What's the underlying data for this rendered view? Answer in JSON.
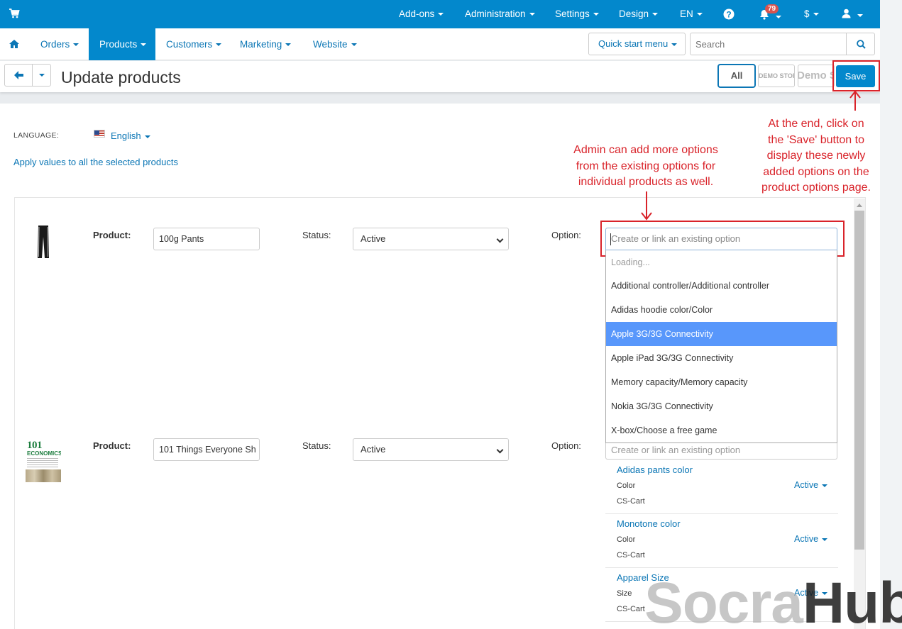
{
  "topbar": {
    "items": [
      {
        "label": "Add-ons"
      },
      {
        "label": "Administration"
      },
      {
        "label": "Settings"
      },
      {
        "label": "Design"
      },
      {
        "label": "EN"
      }
    ],
    "notification_count": "79",
    "currency": "$",
    "icons": [
      "cart-icon",
      "help-icon",
      "bell-icon",
      "user-icon"
    ]
  },
  "nav": {
    "items": [
      {
        "label": "Orders"
      },
      {
        "label": "Products"
      },
      {
        "label": "Customers"
      },
      {
        "label": "Marketing"
      },
      {
        "label": "Website"
      }
    ],
    "quick_start": "Quick start menu",
    "search_placeholder": "Search"
  },
  "header": {
    "title": "Update products",
    "storefront_all": "All",
    "storefront_1": "DEMO STORE",
    "storefront_2": "Demo Store",
    "save": "Save"
  },
  "language": {
    "label": "LANGUAGE:",
    "value": "English"
  },
  "apply_link": "Apply values to all the selected products",
  "products": [
    {
      "product_label": "Product:",
      "name": "100g Pants",
      "status_label": "Status:",
      "status": "Active",
      "option_label": "Option:",
      "option_placeholder": "Create or link an existing option"
    },
    {
      "product_label": "Product:",
      "name": "101 Things Everyone Sh",
      "status_label": "Status:",
      "status": "Active",
      "option_label": "Option:",
      "option_placeholder": "Create or link an existing option",
      "image_text": {
        "number": "101",
        "title": "ECONOMICS"
      }
    }
  ],
  "dropdown": {
    "items": [
      "Loading...",
      "Additional controller/Additional controller",
      "Adidas hoodie color/Color",
      "Apple 3G/3G Connectivity",
      "Apple iPad 3G/3G Connectivity",
      "Memory capacity/Memory capacity",
      "Nokia 3G/3G Connectivity",
      "X-box/Choose a free game"
    ],
    "highlighted_index": 3
  },
  "linked_options": [
    {
      "name": "Adidas pants color",
      "type": "Color",
      "vendor": "CS-Cart",
      "status": "Active"
    },
    {
      "name": "Monotone color",
      "type": "Color",
      "vendor": "CS-Cart",
      "status": "Active"
    },
    {
      "name": "Apparel Size",
      "type": "Size",
      "vendor": "CS-Cart",
      "status": "Active"
    }
  ],
  "annotations": {
    "options_note": [
      "Admin can add more options",
      "from the existing options for",
      "individual products as well."
    ],
    "save_note": [
      "At the end, click on",
      "the 'Save' button to",
      "display these newly",
      "added options on the",
      "product options page."
    ]
  },
  "watermark": {
    "part1": "Socra",
    "part2": "Hub"
  },
  "colors": {
    "primary": "#0388cc",
    "link": "#0b76b5",
    "highlight": "#5897fb",
    "annotation": "#d9232a",
    "badge": "#d9534f"
  }
}
